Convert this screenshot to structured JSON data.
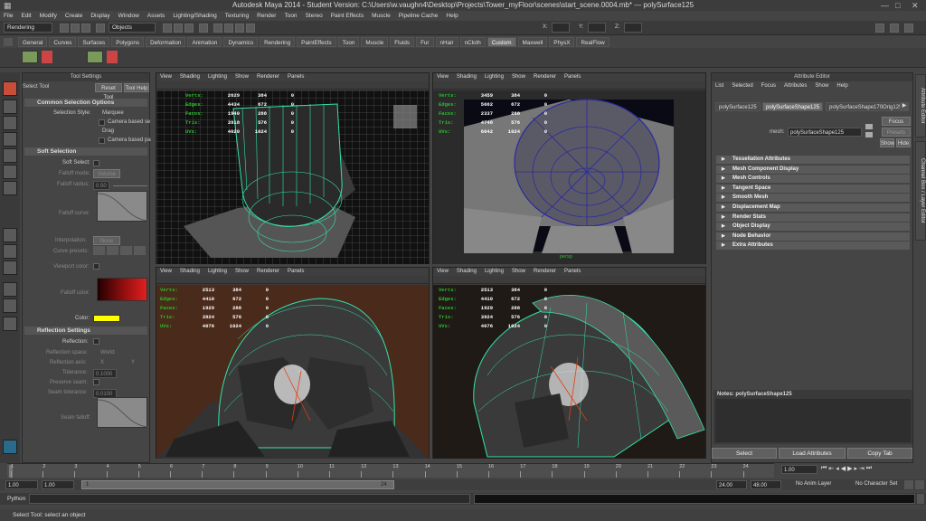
{
  "window": {
    "title": "Autodesk Maya 2014 - Student Version: C:\\Users\\w.vaughn4\\Desktop\\Projects\\Tower_myFloor\\scenes\\start_scene.0004.mb*   ---   polySurface125"
  },
  "menubar": [
    "File",
    "Edit",
    "Modify",
    "Create",
    "Display",
    "Window",
    "Assets",
    "Lighting/Shading",
    "Texturing",
    "Render",
    "Toon",
    "Stereo",
    "Paint Effects",
    "Muscle",
    "Pipeline Cache",
    "Help"
  ],
  "status": {
    "mode": "Rendering",
    "selmode": "Objects",
    "x_label": "X:",
    "y_label": "Y:",
    "z_label": "Z:"
  },
  "shelf_tabs": [
    "General",
    "Curves",
    "Surfaces",
    "Polygons",
    "Deformation",
    "Animation",
    "Dynamics",
    "Rendering",
    "PaintEffects",
    "Toon",
    "Muscle",
    "Fluids",
    "Fur",
    "nHair",
    "nCloth",
    "Custom",
    "Maxwell",
    "PhysX",
    "RealFlow"
  ],
  "shelf_active": "Custom",
  "tool_settings": {
    "header": "Tool Settings",
    "tool_name": "Select Tool",
    "reset": "Reset Tool",
    "help": "Tool Help",
    "common": "Common Selection Options",
    "sel_style": "Selection Style:",
    "marquee": "Marquee",
    "camera_based": "Camera based se",
    "drag": "Drag",
    "camera_based_pa": "Camera based pa",
    "soft": "Soft Selection",
    "soft_select": "Soft Select:",
    "falloff_mode": "Falloff mode:",
    "falloff_mode_val": "Volume",
    "falloff_radius": "Falloff radius:",
    "falloff_radius_val": "0.50",
    "falloff_curve": "Falloff curve:",
    "interpolation": "Interpolation:",
    "interp_val": "None",
    "curve_presets": "Curve presets:",
    "viewport_color": "Viewport color:",
    "falloff_color": "Falloff color:",
    "color": "Color:",
    "reflection": "Reflection Settings",
    "reflection_lbl": "Reflection:",
    "refl_space": "Reflection space:",
    "refl_space_val": "World",
    "refl_axis": "Reflection axis:",
    "axis_x": "X",
    "axis_y": "Y",
    "tolerance": "Tolerance:",
    "tolerance_val": "0.1000",
    "preserve": "Preserve seam:",
    "seam_tol": "Seam tolerance:",
    "seam_tol_val": "0.0100",
    "seam_falloff": "Seam falloff:"
  },
  "viewport_menu": [
    "View",
    "Shading",
    "Lighting",
    "Show",
    "Renderer",
    "Panels"
  ],
  "huds": [
    {
      "rows": [
        [
          "Verts:",
          "2629",
          "384",
          "0"
        ],
        [
          "Edges:",
          "4434",
          "672",
          "0"
        ],
        [
          "Faces:",
          "1940",
          "288",
          "0"
        ],
        [
          "Tris:",
          "3918",
          "576",
          "0"
        ],
        [
          "UVs:",
          "4020",
          "1024",
          "0"
        ]
      ]
    },
    {
      "rows": [
        [
          "Verts:",
          "3459",
          "384",
          "0"
        ],
        [
          "Edges:",
          "5662",
          "672",
          "0"
        ],
        [
          "Faces:",
          "2337",
          "288",
          "0"
        ],
        [
          "Tris:",
          "4748",
          "576",
          "0"
        ],
        [
          "UVs:",
          "6042",
          "1024",
          "0"
        ]
      ]
    },
    {
      "rows": [
        [
          "Verts:",
          "2513",
          "384",
          "0"
        ],
        [
          "Edges:",
          "4410",
          "672",
          "0"
        ],
        [
          "Faces:",
          "1929",
          "288",
          "0"
        ],
        [
          "Tris:",
          "3924",
          "576",
          "0"
        ],
        [
          "UVs:",
          "4076",
          "1024",
          "0"
        ]
      ]
    },
    {
      "rows": [
        [
          "Verts:",
          "2513",
          "384",
          "0"
        ],
        [
          "Edges:",
          "4410",
          "672",
          "0"
        ],
        [
          "Faces:",
          "1929",
          "288",
          "0"
        ],
        [
          "Tris:",
          "3924",
          "576",
          "0"
        ],
        [
          "UVs:",
          "4076",
          "1024",
          "0"
        ]
      ]
    }
  ],
  "viewport_labels": [
    "persp"
  ],
  "attr_editor": {
    "header": "Attribute Editor",
    "menu": [
      "List",
      "Selected",
      "Focus",
      "Attributes",
      "Show",
      "Help"
    ],
    "tabs": [
      "polySurface125",
      "polySurfaceShape125",
      "polySurfaceShape170Orig125"
    ],
    "active_tab": "polySurfaceShape125",
    "mesh_label": "mesh:",
    "mesh_value": "polySurfaceShape125",
    "focus": "Focus",
    "presets": "Presets",
    "show": "Show",
    "hide": "Hide",
    "sections": [
      "Tessellation Attributes",
      "Mesh Component Display",
      "Mesh Controls",
      "Tangent Space",
      "Smooth Mesh",
      "Displacement Map",
      "Render Stats",
      "Object Display",
      "Node Behavior",
      "Extra Attributes"
    ],
    "notes": "Notes:  polySurfaceShape125",
    "buttons": [
      "Select",
      "Load Attributes",
      "Copy Tab"
    ]
  },
  "side_tabs": [
    "Attribute Editor",
    "Channel Box / Layer Editor"
  ],
  "timeline": {
    "ticks": [
      "1",
      "2",
      "3",
      "4",
      "5",
      "6",
      "7",
      "8",
      "9",
      "10",
      "11",
      "12",
      "13",
      "14",
      "15",
      "16",
      "17",
      "18",
      "19",
      "20",
      "21",
      "22",
      "23",
      "24"
    ],
    "current": "1.00"
  },
  "range": {
    "start": "1.00",
    "start2": "1.00",
    "range_start": "1",
    "range_end": "24",
    "end": "24.00",
    "end2": "48.00",
    "anim_layer": "No Anim Layer",
    "char_set": "No Character Set"
  },
  "command": {
    "lang": "Python"
  },
  "help_line": "Select Tool: select an object",
  "colors": {
    "wire": "#34e3a8",
    "soft_color": "#ffff00"
  }
}
